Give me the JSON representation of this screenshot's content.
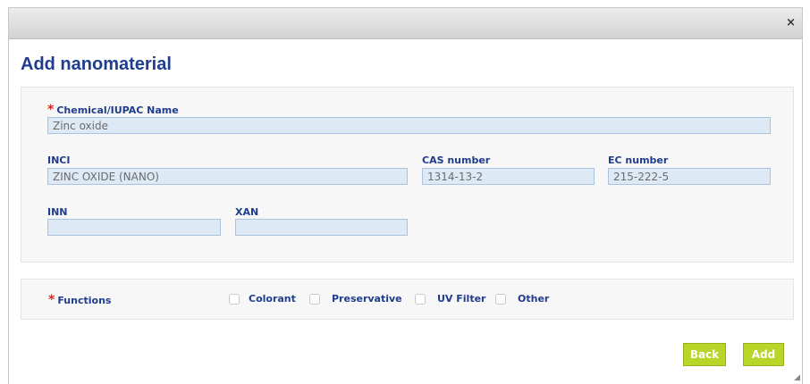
{
  "dialog": {
    "close_glyph": "×",
    "heading": "Add nanomaterial"
  },
  "form": {
    "required_mark": "*",
    "chemical_name": {
      "label": "Chemical/IUPAC Name",
      "value": "Zinc oxide"
    },
    "inci": {
      "label": "INCI",
      "value": "ZINC OXIDE (NANO)"
    },
    "cas": {
      "label": "CAS number",
      "value": "1314-13-2"
    },
    "ec": {
      "label": "EC number",
      "value": "215-222-5"
    },
    "inn": {
      "label": "INN",
      "value": ""
    },
    "xan": {
      "label": "XAN",
      "value": ""
    }
  },
  "functions": {
    "label": "Functions",
    "options": [
      {
        "label": "Colorant",
        "checked": false
      },
      {
        "label": "Preservative",
        "checked": false
      },
      {
        "label": "UV Filter",
        "checked": false
      },
      {
        "label": "Other",
        "checked": false
      }
    ]
  },
  "actions": {
    "back_label": "Back",
    "add_label": "Add"
  },
  "colors": {
    "heading": "#1f3d8c",
    "required": "#d9261c",
    "button": "#b8d62a",
    "input_bg": "#ddeaf6"
  }
}
